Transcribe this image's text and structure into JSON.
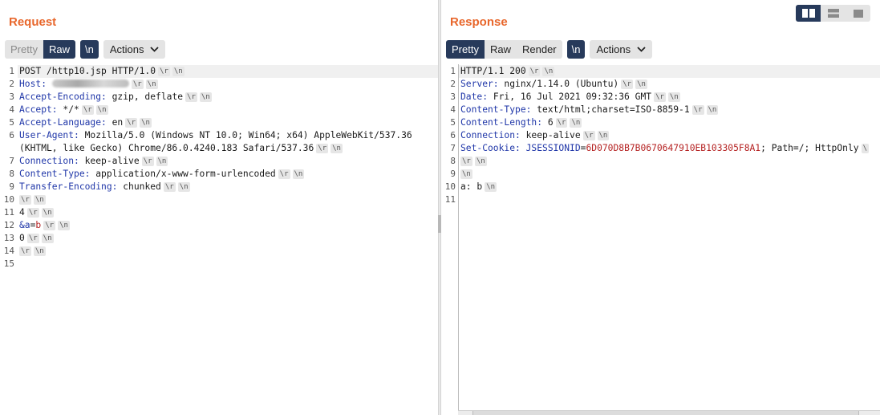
{
  "request": {
    "title": "Request",
    "view_buttons": [
      {
        "label": "Pretty",
        "state": "dim"
      },
      {
        "label": "Raw",
        "state": "active"
      }
    ],
    "newline_label": "\\n",
    "actions_label": "Actions",
    "lines": [
      {
        "n": "1",
        "segs": [
          {
            "t": "POST /http10.jsp HTTP/1.0",
            "c": ""
          }
        ],
        "toks": [
          "\\r",
          "\\n"
        ]
      },
      {
        "n": "2",
        "segs": [
          {
            "t": "Host: ",
            "c": "k"
          }
        ],
        "redacted": true,
        "toks": [
          "\\r",
          "\\n"
        ]
      },
      {
        "n": "3",
        "segs": [
          {
            "t": "Accept-Encoding:",
            "c": "k"
          },
          {
            "t": " gzip, deflate",
            "c": ""
          }
        ],
        "toks": [
          "\\r",
          "\\n"
        ]
      },
      {
        "n": "4",
        "segs": [
          {
            "t": "Accept:",
            "c": "k"
          },
          {
            "t": " */*",
            "c": ""
          }
        ],
        "toks": [
          "\\r",
          "\\n"
        ]
      },
      {
        "n": "5",
        "segs": [
          {
            "t": "Accept-Language:",
            "c": "k"
          },
          {
            "t": " en",
            "c": ""
          }
        ],
        "toks": [
          "\\r",
          "\\n"
        ]
      },
      {
        "n": "6",
        "segs": [
          {
            "t": "User-Agent:",
            "c": "k"
          },
          {
            "t": " Mozilla/5.0 (Windows NT 10.0; Win64; x64) AppleWebKit/537.36",
            "c": ""
          }
        ],
        "toks": []
      },
      {
        "n": "",
        "segs": [
          {
            "t": "(KHTML, like Gecko) Chrome/86.0.4240.183 Safari/537.36",
            "c": ""
          }
        ],
        "toks": [
          "\\r",
          "\\n"
        ]
      },
      {
        "n": "7",
        "segs": [
          {
            "t": "Connection:",
            "c": "k"
          },
          {
            "t": " keep-alive",
            "c": ""
          }
        ],
        "toks": [
          "\\r",
          "\\n"
        ]
      },
      {
        "n": "8",
        "segs": [
          {
            "t": "Content-Type:",
            "c": "k"
          },
          {
            "t": " application/x-www-form-urlencoded",
            "c": ""
          }
        ],
        "toks": [
          "\\r",
          "\\n"
        ]
      },
      {
        "n": "9",
        "segs": [
          {
            "t": "Transfer-Encoding:",
            "c": "k"
          },
          {
            "t": " chunked",
            "c": ""
          }
        ],
        "toks": [
          "\\r",
          "\\n"
        ]
      },
      {
        "n": "10",
        "segs": [],
        "toks": [
          "\\r",
          "\\n"
        ]
      },
      {
        "n": "11",
        "segs": [
          {
            "t": "4",
            "c": ""
          }
        ],
        "toks": [
          "\\r",
          "\\n"
        ]
      },
      {
        "n": "12",
        "segs": [
          {
            "t": "&a",
            "c": "k"
          },
          {
            "t": "=",
            "c": ""
          },
          {
            "t": "b",
            "c": "v"
          }
        ],
        "toks": [
          "\\r",
          "\\n"
        ]
      },
      {
        "n": "13",
        "segs": [
          {
            "t": "0",
            "c": ""
          }
        ],
        "toks": [
          "\\r",
          "\\n"
        ]
      },
      {
        "n": "14",
        "segs": [],
        "toks": [
          "\\r",
          "\\n"
        ]
      },
      {
        "n": "15",
        "segs": [],
        "toks": []
      }
    ]
  },
  "response": {
    "title": "Response",
    "view_buttons": [
      {
        "label": "Pretty",
        "state": "active"
      },
      {
        "label": "Raw",
        "state": "normal"
      },
      {
        "label": "Render",
        "state": "normal"
      }
    ],
    "newline_label": "\\n",
    "actions_label": "Actions",
    "lines": [
      {
        "n": "1",
        "segs": [
          {
            "t": "HTTP/1.1 200",
            "c": ""
          }
        ],
        "toks": [
          "\\r",
          "\\n"
        ]
      },
      {
        "n": "2",
        "segs": [
          {
            "t": "Server:",
            "c": "k"
          },
          {
            "t": " nginx/1.14.0 (Ubuntu)",
            "c": ""
          }
        ],
        "toks": [
          "\\r",
          "\\n"
        ]
      },
      {
        "n": "3",
        "segs": [
          {
            "t": "Date:",
            "c": "k"
          },
          {
            "t": " Fri, 16 Jul 2021 09:32:36 GMT",
            "c": ""
          }
        ],
        "toks": [
          "\\r",
          "\\n"
        ]
      },
      {
        "n": "4",
        "segs": [
          {
            "t": "Content-Type:",
            "c": "k"
          },
          {
            "t": " text/html;charset=ISO-8859-1",
            "c": ""
          }
        ],
        "toks": [
          "\\r",
          "\\n"
        ]
      },
      {
        "n": "5",
        "segs": [
          {
            "t": "Content-Length:",
            "c": "k"
          },
          {
            "t": " 6",
            "c": ""
          }
        ],
        "toks": [
          "\\r",
          "\\n"
        ]
      },
      {
        "n": "6",
        "segs": [
          {
            "t": "Connection:",
            "c": "k"
          },
          {
            "t": " keep-alive",
            "c": ""
          }
        ],
        "toks": [
          "\\r",
          "\\n"
        ]
      },
      {
        "n": "7",
        "segs": [
          {
            "t": "Set-Cookie:",
            "c": "k"
          },
          {
            "t": " JSESSIONID",
            "c": "k"
          },
          {
            "t": "=",
            "c": ""
          },
          {
            "t": "6D070D8B7B0670647910EB103305F8A1",
            "c": "v"
          },
          {
            "t": "; Path=/; HttpOnly",
            "c": ""
          }
        ],
        "toks": [
          "\\"
        ]
      },
      {
        "n": "8",
        "segs": [],
        "toks": [
          "\\r",
          "\\n"
        ]
      },
      {
        "n": "9",
        "segs": [],
        "toks": [
          "\\n"
        ]
      },
      {
        "n": "10",
        "segs": [
          {
            "t": "a: b",
            "c": ""
          }
        ],
        "toks": [
          "\\n"
        ]
      },
      {
        "n": "11",
        "segs": [],
        "toks": []
      }
    ]
  },
  "layout_toggle": {
    "options": [
      "side-by-side",
      "horizontal-split",
      "single-tab"
    ],
    "active": "side-by-side"
  }
}
